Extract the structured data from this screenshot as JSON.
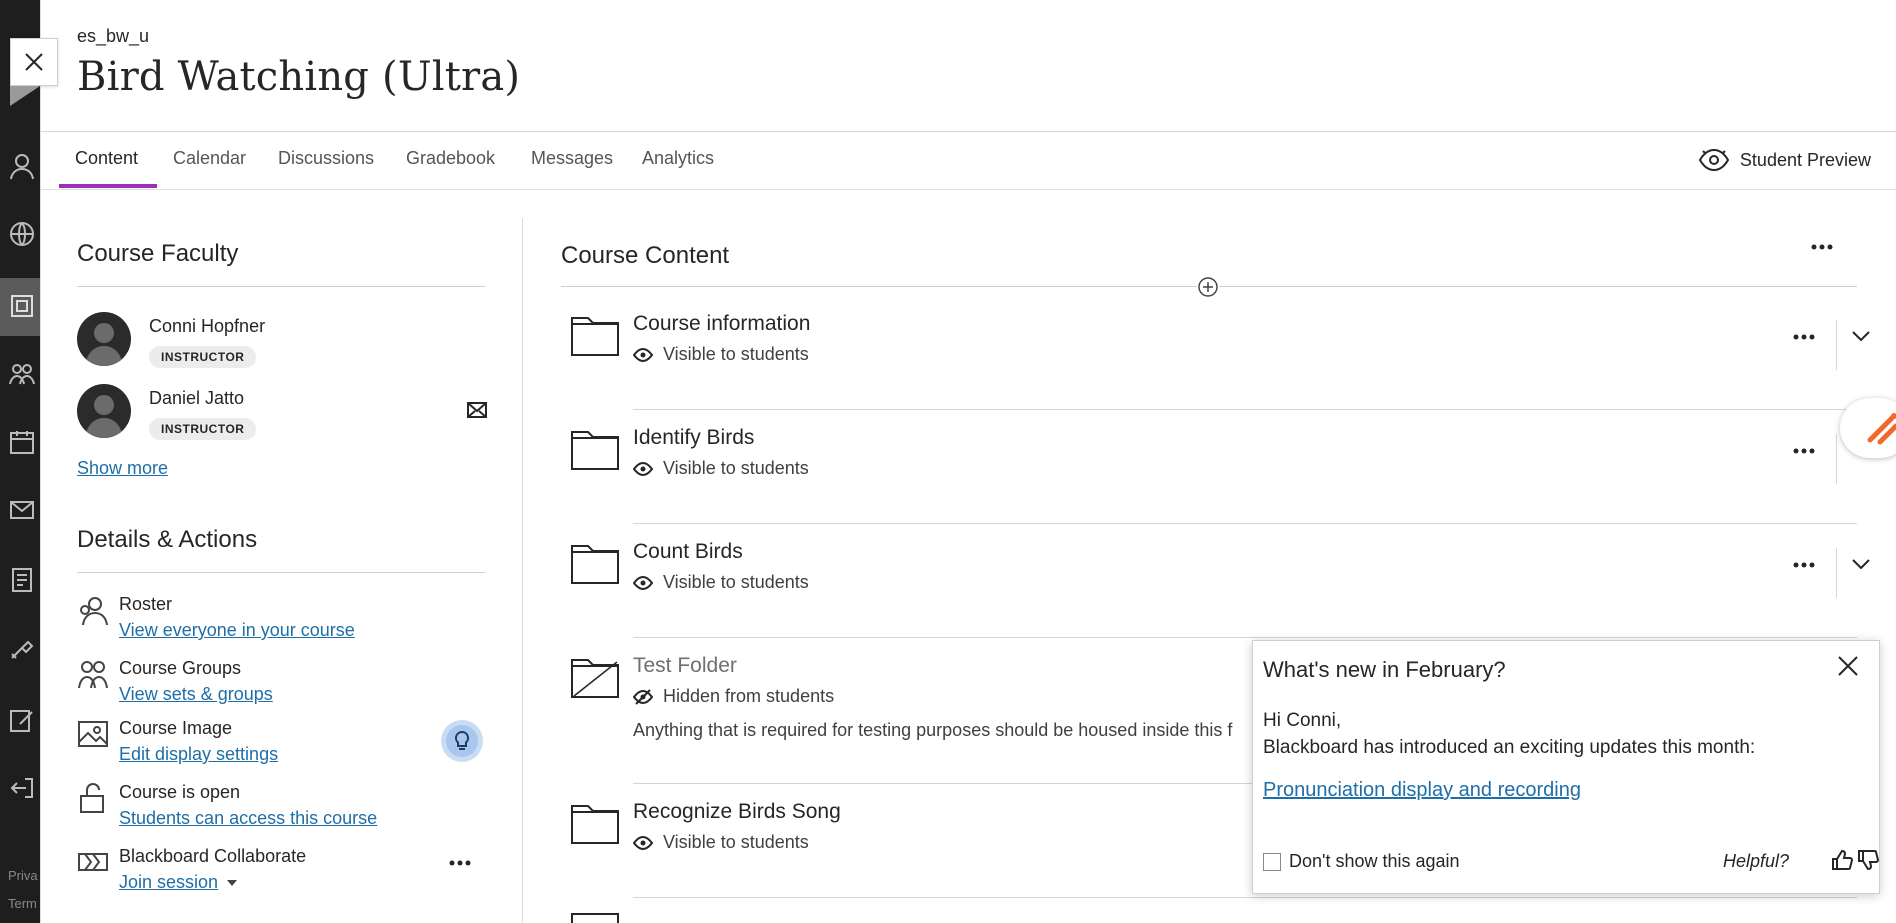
{
  "left_nav": {
    "footer_lines": [
      "Priva",
      "Term"
    ]
  },
  "header": {
    "course_code": "es_bw_u",
    "course_title": "Bird Watching (Ultra)"
  },
  "tabs": [
    {
      "label": "Content"
    },
    {
      "label": "Calendar"
    },
    {
      "label": "Discussions"
    },
    {
      "label": "Gradebook"
    },
    {
      "label": "Messages"
    },
    {
      "label": "Analytics"
    }
  ],
  "student_preview_label": "Student Preview",
  "faculty": {
    "title": "Course Faculty",
    "members": [
      {
        "name": "Conni Hopfner",
        "role": "INSTRUCTOR"
      },
      {
        "name": "Daniel Jatto",
        "role": "INSTRUCTOR"
      }
    ],
    "show_more": "Show more"
  },
  "details": {
    "title": "Details & Actions",
    "items": [
      {
        "title": "Roster",
        "link": "View everyone in your course"
      },
      {
        "title": "Course Groups",
        "link": "View sets & groups"
      },
      {
        "title": "Course Image",
        "link": "Edit display settings"
      },
      {
        "title": "Course is open",
        "link": "Students can access this course"
      },
      {
        "title": "Blackboard Collaborate",
        "link": "Join session"
      }
    ]
  },
  "content": {
    "title": "Course Content",
    "items": [
      {
        "name": "Course information",
        "visibility": "Visible to students"
      },
      {
        "name": "Identify Birds",
        "visibility": "Visible to students"
      },
      {
        "name": "Count Birds",
        "visibility": "Visible to students"
      },
      {
        "name": "Test Folder",
        "visibility": "Hidden from students",
        "description": "Anything that is required for testing purposes should be housed inside this f"
      },
      {
        "name": "Recognize Birds Song",
        "visibility": "Visible to students"
      }
    ]
  },
  "popup": {
    "title": "What's new in February?",
    "greeting": "Hi Conni,",
    "body": "Blackboard has introduced an exciting updates this month:",
    "link": "Pronunciation display and recording",
    "checkbox_label": "Don't show this again",
    "helpful_label": "Helpful?"
  },
  "colors": {
    "accent_tab": "#9f2fb8",
    "link": "#1e6ea7",
    "left_nav_bg": "#1e1e1e",
    "hint_bulb": "#a9c7ec"
  }
}
